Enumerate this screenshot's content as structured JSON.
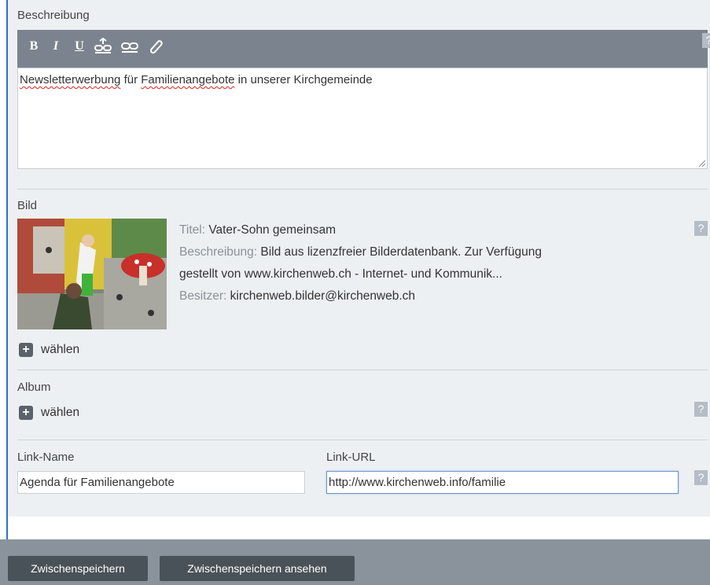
{
  "description": {
    "label": "Beschreibung",
    "help": "?",
    "toolbar": {
      "bold": "B",
      "italic": "I",
      "underline": "U"
    },
    "text_parts": [
      "Newsletterwerbung",
      " für ",
      "Familienangebote",
      " in unserer Kirchgemeinde"
    ]
  },
  "image": {
    "label": "Bild",
    "help": "?",
    "title_key": "Titel:",
    "title_value": " Vater-Sohn gemeinsam",
    "desc_key": "Beschreibung:",
    "desc_value_1": " Bild aus lizenzfreier Bilderdatenbank. Zur Verfügung",
    "desc_value_2": "gestellt von www.kirchenweb.ch - Internet- und Kommunik...",
    "owner_key": "Besitzer:",
    "owner_value": " kirchenweb.bilder@kirchenweb.ch",
    "choose_label": "wählen"
  },
  "album": {
    "label": "Album",
    "help": "?",
    "choose_label": "wählen"
  },
  "link": {
    "name_label": "Link-Name",
    "name_value": "Agenda für Familienangebote",
    "url_label": "Link-URL",
    "url_value": "http://www.kirchenweb.info/familie",
    "help": "?"
  },
  "footer": {
    "save_label": "Zwischenspeichern",
    "preview_label": "Zwischenspeichern ansehen"
  },
  "colors": {
    "accent": "#2f72c4",
    "toolbar": "#7b848e",
    "panel": "#edf0f3",
    "footer": "#8a939b",
    "button": "#4a5259"
  }
}
